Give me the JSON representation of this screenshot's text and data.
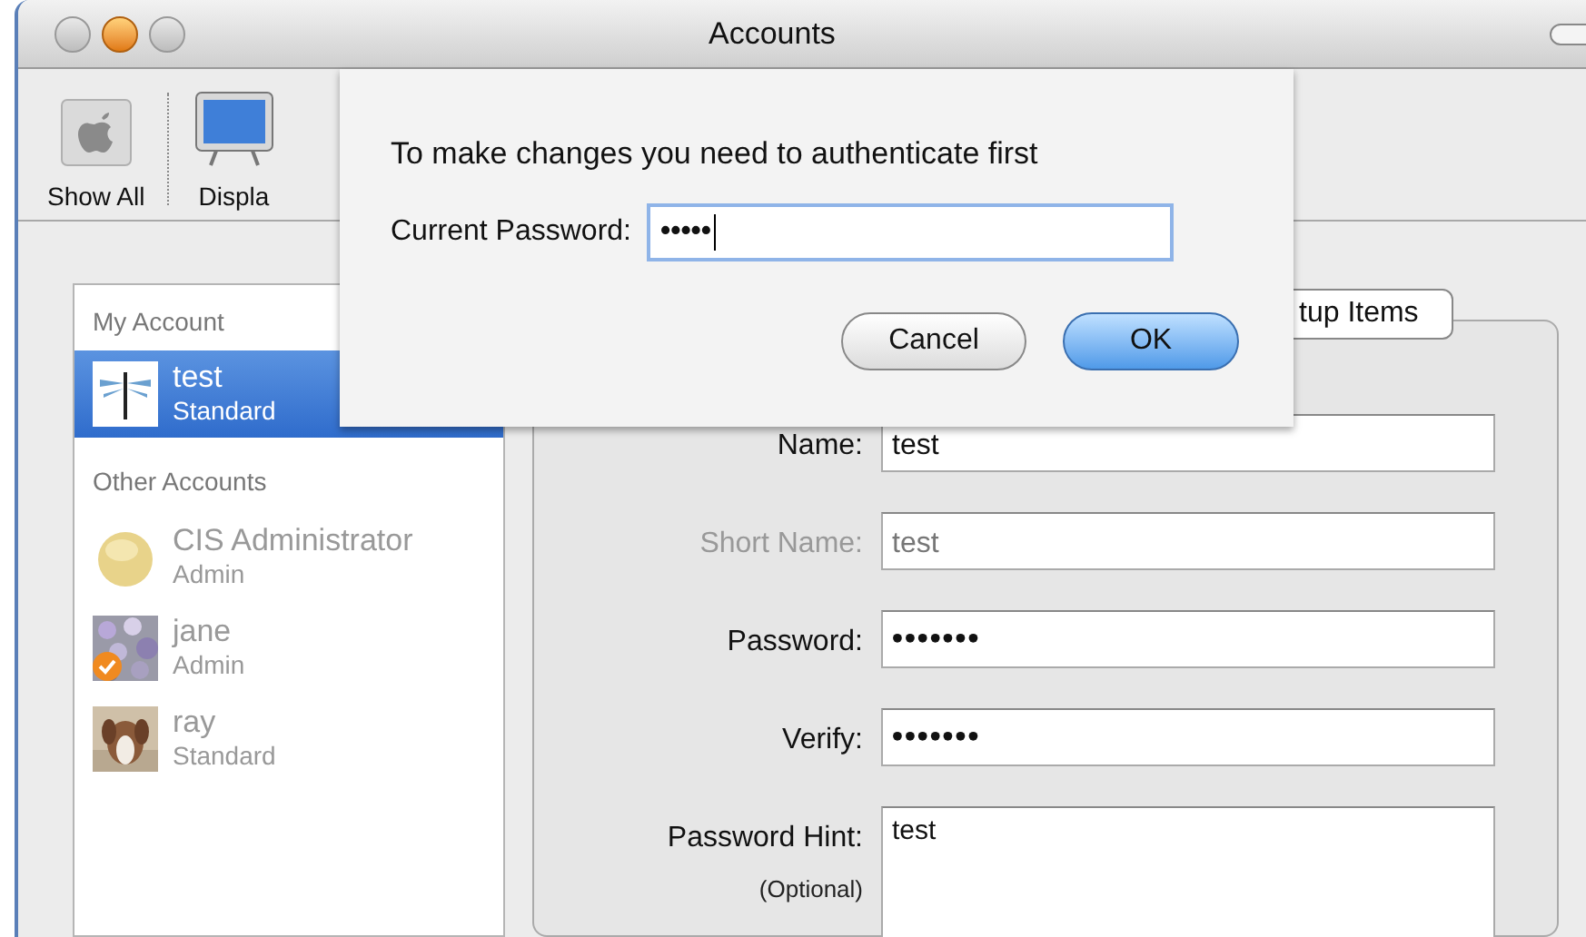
{
  "window": {
    "title": "Accounts"
  },
  "toolbar": [
    {
      "label": "Show All"
    },
    {
      "label": "Displa"
    }
  ],
  "sidebar": {
    "sections": [
      {
        "heading": "My Account",
        "accounts": [
          {
            "name": "test",
            "role": "Standard",
            "selected": true,
            "checkmark": false
          }
        ]
      },
      {
        "heading": "Other Accounts",
        "accounts": [
          {
            "name": "CIS Administrator",
            "role": "Admin",
            "selected": false,
            "checkmark": false
          },
          {
            "name": "jane",
            "role": "Admin",
            "selected": false,
            "checkmark": true
          },
          {
            "name": "ray",
            "role": "Standard",
            "selected": false,
            "checkmark": false
          }
        ]
      }
    ]
  },
  "tabs": [
    {
      "label": "tup Items",
      "selected": true
    }
  ],
  "form": [
    {
      "label": "Name:",
      "value": "test",
      "disabled": false,
      "kind": "text"
    },
    {
      "label": "Short Name:",
      "value": "test",
      "disabled": true,
      "kind": "text"
    },
    {
      "label": "Password:",
      "value": "•••••••",
      "disabled": false,
      "kind": "secret"
    },
    {
      "label": "Verify:",
      "value": "•••••••",
      "disabled": false,
      "kind": "secret"
    },
    {
      "label": "Password Hint:",
      "sublabel": "(Optional)",
      "value": "test",
      "disabled": false,
      "kind": "area"
    }
  ],
  "sheet": {
    "message": "To make changes you need to authenticate first",
    "field_label": "Current Password:",
    "field_value": "•••••",
    "buttons": [
      {
        "label": "Cancel",
        "default": false
      },
      {
        "label": "OK",
        "default": true
      }
    ]
  }
}
